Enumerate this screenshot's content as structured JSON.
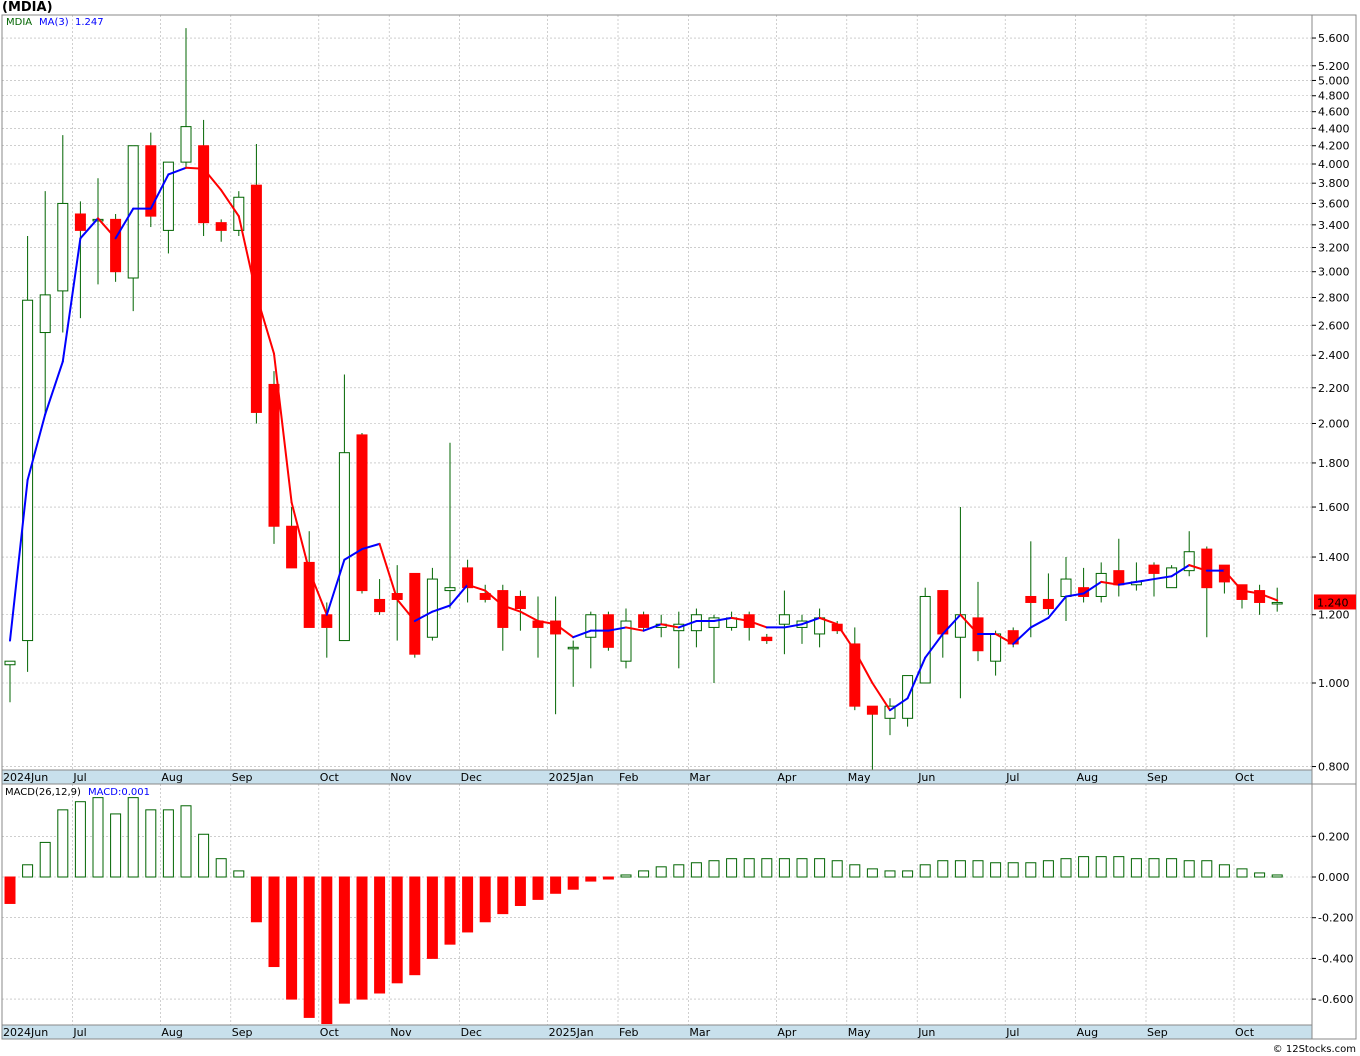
{
  "title": "(MDIA)",
  "watermark": "© 12Stocks.com",
  "price_panel": {
    "legend_symbol": "MDIA",
    "legend_ma_label": "MA(3)",
    "legend_ma_value": "1.247",
    "last_price_label": "1.240"
  },
  "macd_panel": {
    "legend_label": "MACD(26,12,9)",
    "legend_value": "MACD:0.001"
  },
  "colors": {
    "up_candle_border": "#006400",
    "down_candle_fill": "#ff0000",
    "ma_up": "#0000ff",
    "ma_down": "#ff0000",
    "macd_pos_border": "#006400",
    "macd_neg_fill": "#ff0000",
    "label_bg": "#ff0000",
    "time_bar": "#c8e0ec"
  },
  "chart_data": [
    {
      "type": "candlestick",
      "scale": "log",
      "ylim": [
        0.8,
        5.9
      ],
      "grid": true,
      "y_ticks": [
        "5.600",
        "5.200",
        "5.000",
        "4.800",
        "4.600",
        "4.400",
        "4.200",
        "4.000",
        "3.800",
        "3.600",
        "3.400",
        "3.200",
        "3.000",
        "2.800",
        "2.600",
        "2.400",
        "2.200",
        "2.000",
        "1.800",
        "1.600",
        "1.400",
        "1.200",
        "1.000",
        "0.800"
      ],
      "x_labels": [
        {
          "label": "2024Jun",
          "week": 0
        },
        {
          "label": "Jul",
          "week": 4
        },
        {
          "label": "Aug",
          "week": 9
        },
        {
          "label": "Sep",
          "week": 13
        },
        {
          "label": "Oct",
          "week": 18
        },
        {
          "label": "Nov",
          "week": 22
        },
        {
          "label": "Dec",
          "week": 26
        },
        {
          "label": "2025Jan",
          "week": 31
        },
        {
          "label": "Feb",
          "week": 35
        },
        {
          "label": "Mar",
          "week": 39
        },
        {
          "label": "Apr",
          "week": 44
        },
        {
          "label": "May",
          "week": 48
        },
        {
          "label": "Jun",
          "week": 52
        },
        {
          "label": "Jul",
          "week": 57
        },
        {
          "label": "Aug",
          "week": 61
        },
        {
          "label": "Sep",
          "week": 65
        },
        {
          "label": "Oct",
          "week": 70
        }
      ],
      "candles": [
        [
          1.05,
          1.06,
          0.95,
          1.06
        ],
        [
          1.12,
          3.3,
          1.03,
          2.78
        ],
        [
          2.55,
          3.72,
          2.05,
          2.82
        ],
        [
          2.85,
          4.32,
          2.55,
          3.6
        ],
        [
          3.5,
          3.62,
          2.65,
          3.35
        ],
        [
          3.45,
          3.85,
          2.9,
          3.45
        ],
        [
          3.45,
          3.5,
          2.92,
          3.0
        ],
        [
          2.95,
          4.2,
          2.7,
          4.2
        ],
        [
          4.2,
          4.35,
          3.38,
          3.48
        ],
        [
          3.35,
          4.02,
          3.15,
          4.02
        ],
        [
          4.02,
          5.75,
          3.95,
          4.42
        ],
        [
          4.2,
          4.5,
          3.3,
          3.42
        ],
        [
          3.42,
          3.45,
          3.25,
          3.35
        ],
        [
          3.35,
          3.72,
          3.3,
          3.66
        ],
        [
          3.78,
          4.22,
          2.0,
          2.06
        ],
        [
          2.22,
          2.3,
          1.45,
          1.52
        ],
        [
          1.52,
          1.6,
          1.36,
          1.36
        ],
        [
          1.38,
          1.5,
          1.16,
          1.16
        ],
        [
          1.2,
          1.24,
          1.07,
          1.16
        ],
        [
          1.12,
          2.28,
          1.12,
          1.85
        ],
        [
          1.94,
          1.95,
          1.27,
          1.28
        ],
        [
          1.25,
          1.32,
          1.2,
          1.21
        ],
        [
          1.27,
          1.37,
          1.12,
          1.25
        ],
        [
          1.34,
          1.34,
          1.07,
          1.08
        ],
        [
          1.13,
          1.36,
          1.12,
          1.32
        ],
        [
          1.28,
          1.9,
          1.22,
          1.29
        ],
        [
          1.36,
          1.39,
          1.24,
          1.29
        ],
        [
          1.27,
          1.3,
          1.24,
          1.25
        ],
        [
          1.28,
          1.3,
          1.09,
          1.16
        ],
        [
          1.26,
          1.28,
          1.15,
          1.22
        ],
        [
          1.18,
          1.26,
          1.07,
          1.16
        ],
        [
          1.18,
          1.26,
          0.92,
          1.14
        ],
        [
          1.1,
          1.12,
          0.99,
          1.1
        ],
        [
          1.13,
          1.21,
          1.04,
          1.2
        ],
        [
          1.2,
          1.21,
          1.09,
          1.1
        ],
        [
          1.06,
          1.22,
          1.04,
          1.18
        ],
        [
          1.2,
          1.21,
          1.15,
          1.16
        ],
        [
          1.16,
          1.2,
          1.13,
          1.17
        ],
        [
          1.15,
          1.21,
          1.04,
          1.17
        ],
        [
          1.15,
          1.22,
          1.1,
          1.2
        ],
        [
          1.16,
          1.2,
          1.0,
          1.19
        ],
        [
          1.16,
          1.21,
          1.15,
          1.19
        ],
        [
          1.2,
          1.21,
          1.12,
          1.16
        ],
        [
          1.13,
          1.14,
          1.11,
          1.12
        ],
        [
          1.17,
          1.28,
          1.08,
          1.2
        ],
        [
          1.16,
          1.2,
          1.11,
          1.18
        ],
        [
          1.14,
          1.22,
          1.1,
          1.19
        ],
        [
          1.17,
          1.18,
          1.14,
          1.15
        ],
        [
          1.11,
          1.16,
          0.93,
          0.94
        ],
        [
          0.94,
          0.94,
          0.79,
          0.92
        ],
        [
          0.91,
          0.96,
          0.87,
          0.94
        ],
        [
          0.91,
          1.01,
          0.89,
          1.02
        ],
        [
          1.0,
          1.29,
          1.0,
          1.26
        ],
        [
          1.28,
          1.28,
          1.07,
          1.14
        ],
        [
          1.13,
          1.6,
          0.96,
          1.2
        ],
        [
          1.19,
          1.31,
          1.06,
          1.09
        ],
        [
          1.06,
          1.15,
          1.02,
          1.14
        ],
        [
          1.15,
          1.16,
          1.1,
          1.11
        ],
        [
          1.26,
          1.46,
          1.13,
          1.24
        ],
        [
          1.25,
          1.34,
          1.2,
          1.22
        ],
        [
          1.26,
          1.4,
          1.18,
          1.32
        ],
        [
          1.29,
          1.36,
          1.24,
          1.26
        ],
        [
          1.26,
          1.38,
          1.24,
          1.34
        ],
        [
          1.35,
          1.47,
          1.26,
          1.3
        ],
        [
          1.3,
          1.38,
          1.28,
          1.31
        ],
        [
          1.37,
          1.38,
          1.26,
          1.34
        ],
        [
          1.29,
          1.37,
          1.29,
          1.36
        ],
        [
          1.35,
          1.5,
          1.33,
          1.42
        ],
        [
          1.43,
          1.44,
          1.13,
          1.29
        ],
        [
          1.37,
          1.37,
          1.27,
          1.31
        ],
        [
          1.3,
          1.3,
          1.22,
          1.25
        ],
        [
          1.28,
          1.3,
          1.2,
          1.24
        ],
        [
          1.24,
          1.29,
          1.21,
          1.24
        ]
      ],
      "ma3": [
        1.12,
        1.72,
        2.05,
        2.36,
        3.28,
        3.46,
        3.28,
        3.55,
        3.55,
        3.89,
        3.96,
        3.95,
        3.73,
        3.48,
        2.82,
        2.41,
        1.62,
        1.35,
        1.2,
        1.39,
        1.43,
        1.45,
        1.25,
        1.18,
        1.21,
        1.23,
        1.3,
        1.28,
        1.23,
        1.21,
        1.18,
        1.17,
        1.13,
        1.15,
        1.15,
        1.16,
        1.15,
        1.17,
        1.16,
        1.18,
        1.18,
        1.19,
        1.18,
        1.16,
        1.16,
        1.17,
        1.19,
        1.17,
        1.09,
        1.0,
        0.93,
        0.96,
        1.07,
        1.14,
        1.2,
        1.14,
        1.14,
        1.11,
        1.16,
        1.19,
        1.26,
        1.27,
        1.31,
        1.3,
        1.31,
        1.32,
        1.33,
        1.37,
        1.35,
        1.35,
        1.28,
        1.27,
        1.247
      ]
    },
    {
      "type": "bar",
      "ylim": [
        -0.72,
        0.4
      ],
      "grid": true,
      "y_ticks": [
        "0.200",
        "0.000",
        "-0.200",
        "-0.400",
        "-0.600"
      ],
      "values": [
        -0.13,
        0.06,
        0.17,
        0.33,
        0.37,
        0.39,
        0.31,
        0.39,
        0.33,
        0.33,
        0.35,
        0.21,
        0.09,
        0.03,
        -0.22,
        -0.44,
        -0.6,
        -0.69,
        -0.72,
        -0.62,
        -0.6,
        -0.57,
        -0.52,
        -0.48,
        -0.4,
        -0.33,
        -0.27,
        -0.22,
        -0.18,
        -0.14,
        -0.11,
        -0.08,
        -0.06,
        -0.02,
        -0.01,
        0.01,
        0.03,
        0.05,
        0.06,
        0.07,
        0.08,
        0.09,
        0.09,
        0.09,
        0.09,
        0.09,
        0.09,
        0.08,
        0.06,
        0.04,
        0.03,
        0.03,
        0.06,
        0.08,
        0.08,
        0.08,
        0.07,
        0.07,
        0.07,
        0.08,
        0.09,
        0.1,
        0.1,
        0.1,
        0.09,
        0.09,
        0.09,
        0.08,
        0.08,
        0.06,
        0.04,
        0.02,
        0.01
      ]
    }
  ]
}
